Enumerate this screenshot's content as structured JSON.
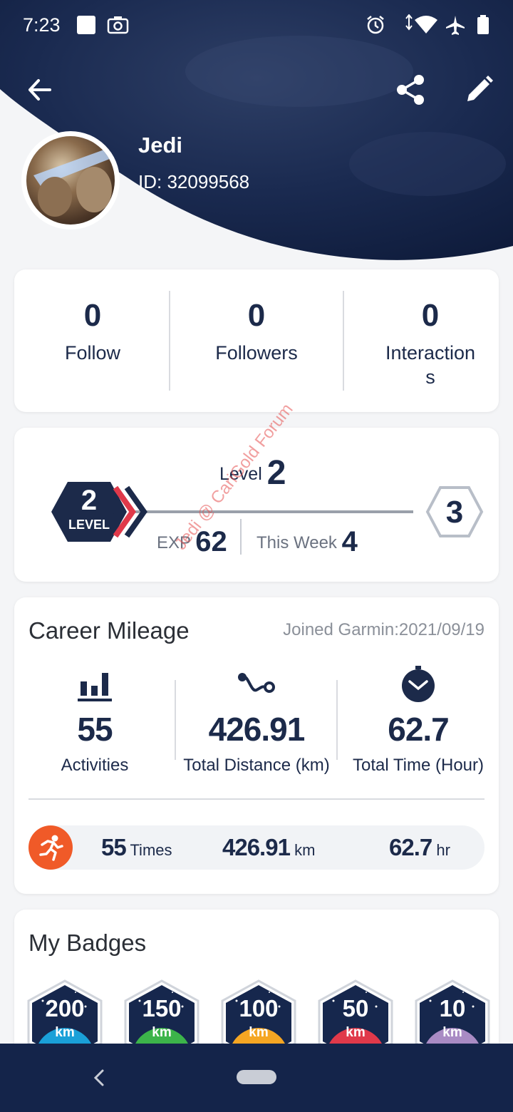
{
  "status_bar": {
    "time": "7:23"
  },
  "profile": {
    "name": "Jedi",
    "id_text": "ID: 32099568"
  },
  "social": [
    {
      "count": "0",
      "label": "Follow"
    },
    {
      "count": "0",
      "label": "Followers"
    },
    {
      "count": "0",
      "label": "Interaction\ns"
    }
  ],
  "level": {
    "title_prefix": "Level",
    "current": "2",
    "badge_level_word": "LEVEL",
    "next": "3",
    "exp_label": "EXP",
    "exp_value": "62",
    "week_label": "This Week",
    "week_value": "4"
  },
  "career": {
    "title": "Career Mileage",
    "joined": "Joined Garmin:2021/09/19",
    "stats": [
      {
        "value": "55",
        "label": "Activities",
        "icon": "bar-chart-icon"
      },
      {
        "value": "426.91",
        "label": "Total Distance (km)",
        "icon": "route-icon"
      },
      {
        "value": "62.7",
        "label": "Total Time (Hour)",
        "icon": "clock-icon"
      }
    ],
    "running": {
      "times_value": "55",
      "times_unit": "Times",
      "distance_value": "426.91",
      "distance_unit": "km",
      "time_value": "62.7",
      "time_unit": "hr"
    }
  },
  "badges": {
    "title": "My Badges",
    "items": [
      {
        "value": "200",
        "unit": "km",
        "color": "#1aa0d8"
      },
      {
        "value": "150",
        "unit": "km",
        "color": "#3cb44a"
      },
      {
        "value": "100",
        "unit": "km",
        "color": "#f5a623"
      },
      {
        "value": "50",
        "unit": "km",
        "color": "#e0394a"
      },
      {
        "value": "10",
        "unit": "km",
        "color": "#a98bc4"
      }
    ]
  },
  "watermark": "Jedi @ CariGold Forum",
  "colors": {
    "navy": "#14244a",
    "accent_red": "#e0394a",
    "run_orange": "#f05a28"
  }
}
